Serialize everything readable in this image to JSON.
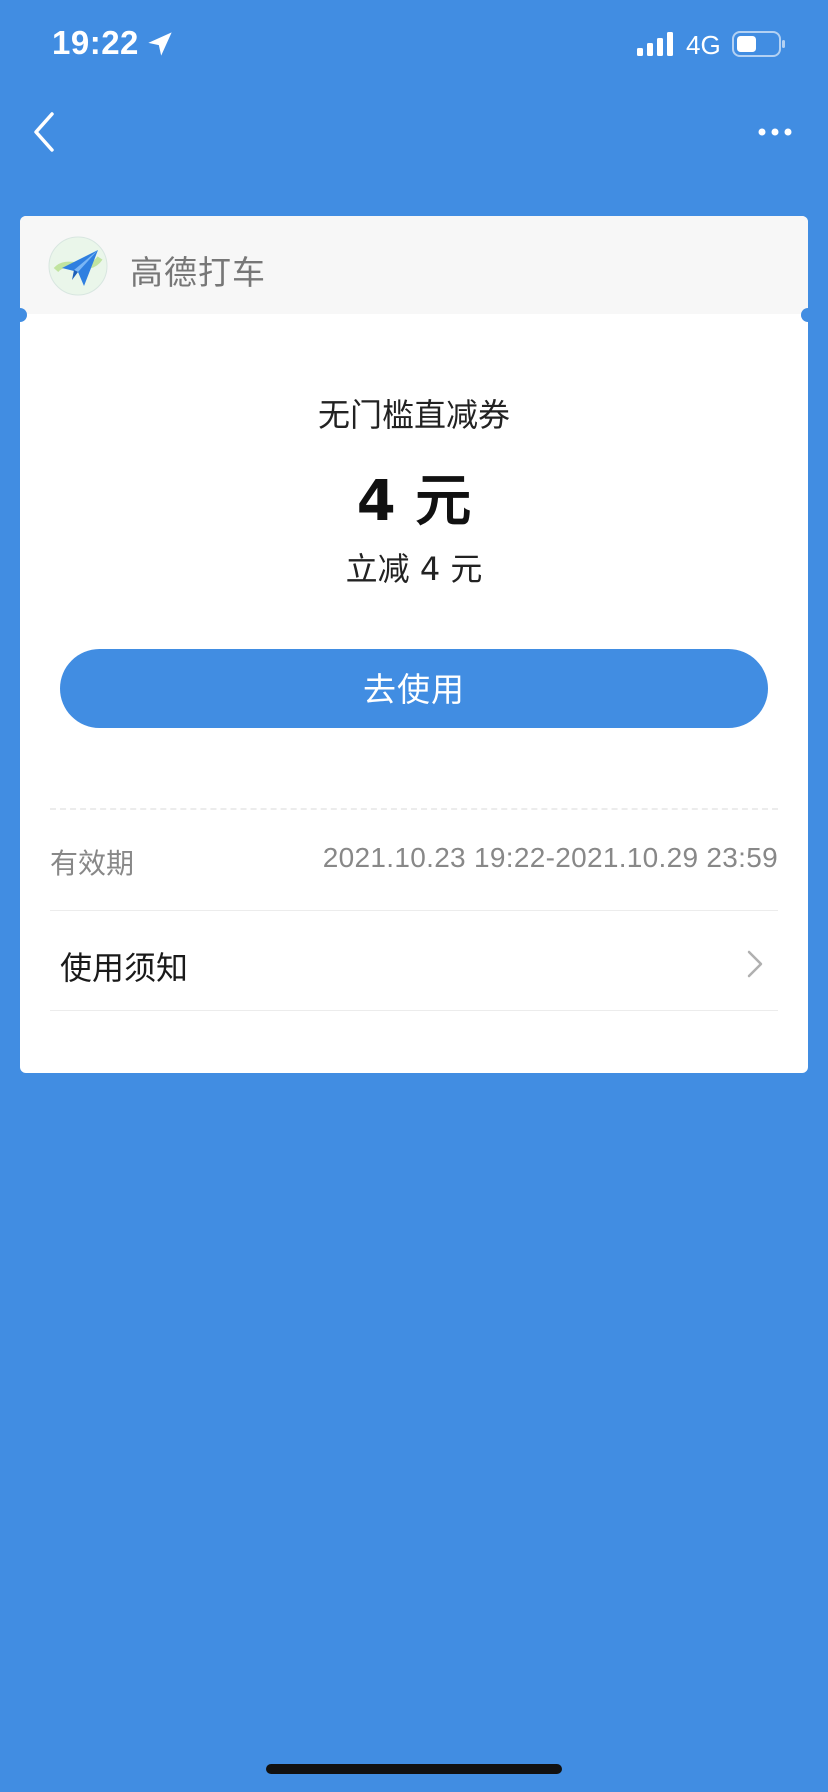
{
  "status_bar": {
    "time": "19:22",
    "network": "4G"
  },
  "brand": {
    "name": "高德打车"
  },
  "coupon": {
    "type": "无门槛直减券",
    "amount": "4 元",
    "description": "立减 4 元",
    "use_button_label": "去使用"
  },
  "details": {
    "validity_label": "有效期",
    "validity_value": "2021.10.23 19:22-2021.10.29 23:59",
    "notice_label": "使用须知"
  },
  "colors": {
    "background": "#418de2",
    "accent": "#418de2",
    "card": "#ffffff"
  },
  "icons": {
    "back": "chevron-left-icon",
    "more": "more-dots-icon",
    "location": "location-arrow-icon",
    "signal": "signal-bars-icon",
    "battery": "battery-icon",
    "logo": "paper-plane-logo-icon",
    "chevron": "chevron-right-icon"
  }
}
